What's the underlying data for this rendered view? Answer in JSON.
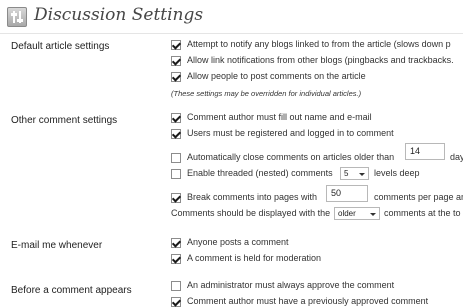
{
  "page_title": "Discussion Settings",
  "sections": {
    "default_article": {
      "label": "Default article settings",
      "options": [
        {
          "text": "Attempt to notify any blogs linked to from the article (slows down p",
          "checked": true
        },
        {
          "text": "Allow link notifications from other blogs (pingbacks and trackbacks.",
          "checked": true
        },
        {
          "text": "Allow people to post comments on the article",
          "checked": true
        }
      ],
      "note": "(These settings may be overridden for individual articles.)"
    },
    "other_comment": {
      "label": "Other comment settings",
      "author_fill": {
        "text": "Comment author must fill out name and e-mail",
        "checked": true
      },
      "registered": {
        "text": "Users must be registered and logged in to comment",
        "checked": true
      },
      "auto_close": {
        "prefix": "Automatically close comments on articles older than",
        "value": "14",
        "suffix": "day",
        "checked": false
      },
      "threaded": {
        "prefix": "Enable threaded (nested) comments",
        "value": "5",
        "suffix": "levels deep",
        "checked": false
      },
      "pages": {
        "prefix": "Break comments into pages with",
        "value": "50",
        "suffix": "comments per page an",
        "checked": true
      },
      "display": {
        "prefix": "Comments should be displayed with the",
        "value": "older",
        "suffix": "comments at the to"
      }
    },
    "email": {
      "label": "E-mail me whenever",
      "options": [
        {
          "text": "Anyone posts a comment",
          "checked": true
        },
        {
          "text": "A comment is held for moderation",
          "checked": true
        }
      ]
    },
    "before_comment": {
      "label": "Before a comment appears",
      "options": [
        {
          "text": "An administrator must always approve the comment",
          "checked": false
        },
        {
          "text": "Comment author must have a previously approved comment",
          "checked": true
        }
      ]
    }
  }
}
